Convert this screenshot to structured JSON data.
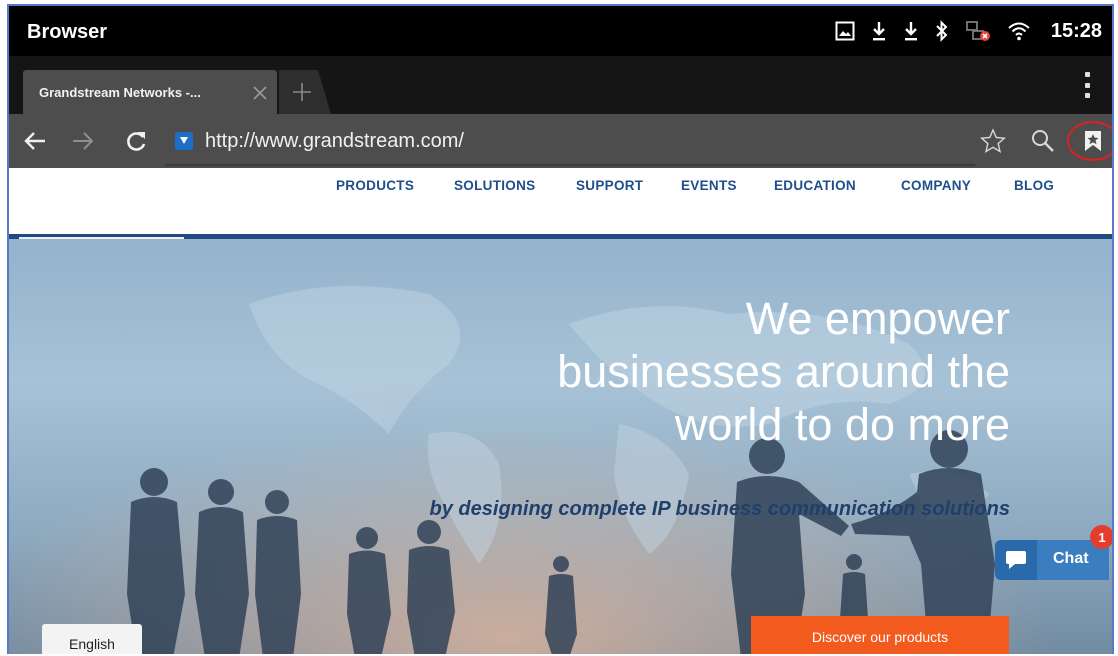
{
  "statusbar": {
    "app_title": "Browser",
    "time": "15:28",
    "icons": [
      "screenshot-icon",
      "download-icon",
      "download-icon",
      "bluetooth-icon",
      "network-error-icon",
      "wifi-icon"
    ]
  },
  "tabs": {
    "active_title": "Grandstream Networks -...",
    "close_icon": "close-icon",
    "new_tab_icon": "plus-icon",
    "overflow_icon": "overflow-menu-icon"
  },
  "toolbar": {
    "url": "http://www.grandstream.com/",
    "icons": [
      "back-icon",
      "forward-icon",
      "reload-icon",
      "favicon-icon",
      "star-icon",
      "search-icon",
      "bookmarks-icon"
    ]
  },
  "site_nav": [
    "PRODUCTS",
    "SOLUTIONS",
    "SUPPORT",
    "EVENTS",
    "EDUCATION",
    "COMPANY",
    "BLOG"
  ],
  "hero": {
    "headline": [
      "We empower",
      "businesses around the",
      "world to do more"
    ],
    "subheadline": "by designing complete IP business communication solutions",
    "language_button": "English",
    "cta_button": "Discover our products",
    "chat_label": "Chat",
    "chat_badge": "1"
  },
  "colors": {
    "nav_link": "#1f4e8c",
    "cta": "#f35a1e",
    "chat": "#3a7ec0",
    "highlight_circle": "#e02020"
  }
}
